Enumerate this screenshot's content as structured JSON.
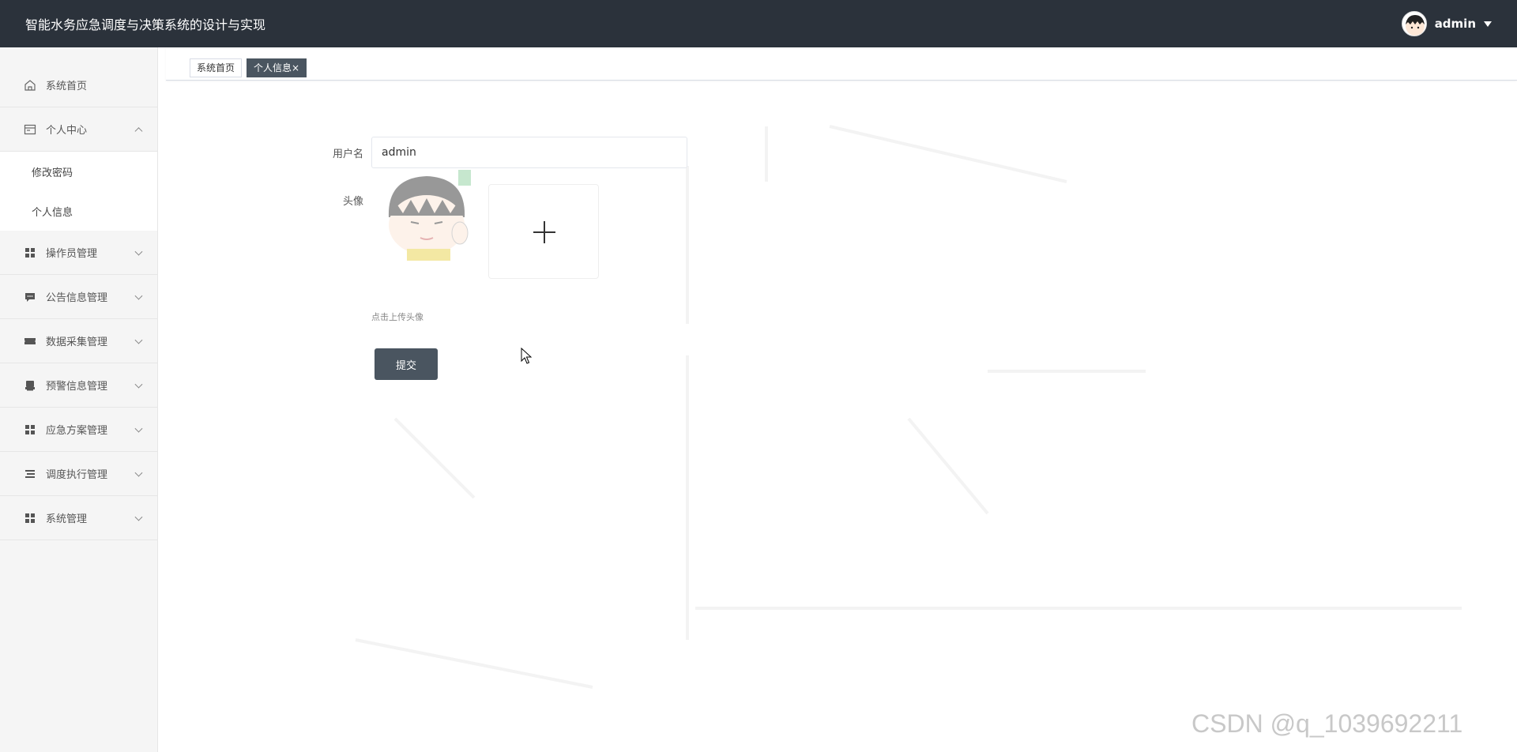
{
  "header": {
    "title": "智能水务应急调度与决策系统的设计与实现",
    "user_name": "admin"
  },
  "sidebar": {
    "items": [
      {
        "label": "系统首页",
        "icon": "home-icon"
      },
      {
        "label": "个人中心",
        "icon": "profile-card-icon",
        "expanded": true,
        "children": [
          {
            "label": "修改密码"
          },
          {
            "label": "个人信息"
          }
        ]
      },
      {
        "label": "操作员管理",
        "icon": "grid-icon"
      },
      {
        "label": "公告信息管理",
        "icon": "chat-icon"
      },
      {
        "label": "数据采集管理",
        "icon": "ticket-icon"
      },
      {
        "label": "预警信息管理",
        "icon": "printer-icon"
      },
      {
        "label": "应急方案管理",
        "icon": "grid-icon"
      },
      {
        "label": "调度执行管理",
        "icon": "list-icon"
      },
      {
        "label": "系统管理",
        "icon": "grid-icon"
      }
    ]
  },
  "tabs": [
    {
      "label": "系统首页",
      "active": false
    },
    {
      "label": "个人信息",
      "close": "×",
      "active": true
    }
  ],
  "form": {
    "username_label": "用户名",
    "username_value": "admin",
    "avatar_label": "头像",
    "upload_tip": "点击上传头像",
    "submit_label": "提交"
  },
  "watermark": "CSDN @q_1039692211",
  "colors": {
    "header_bg": "#2b323b",
    "accent": "#4a5560",
    "sidebar_bg": "#f5f5f5"
  }
}
